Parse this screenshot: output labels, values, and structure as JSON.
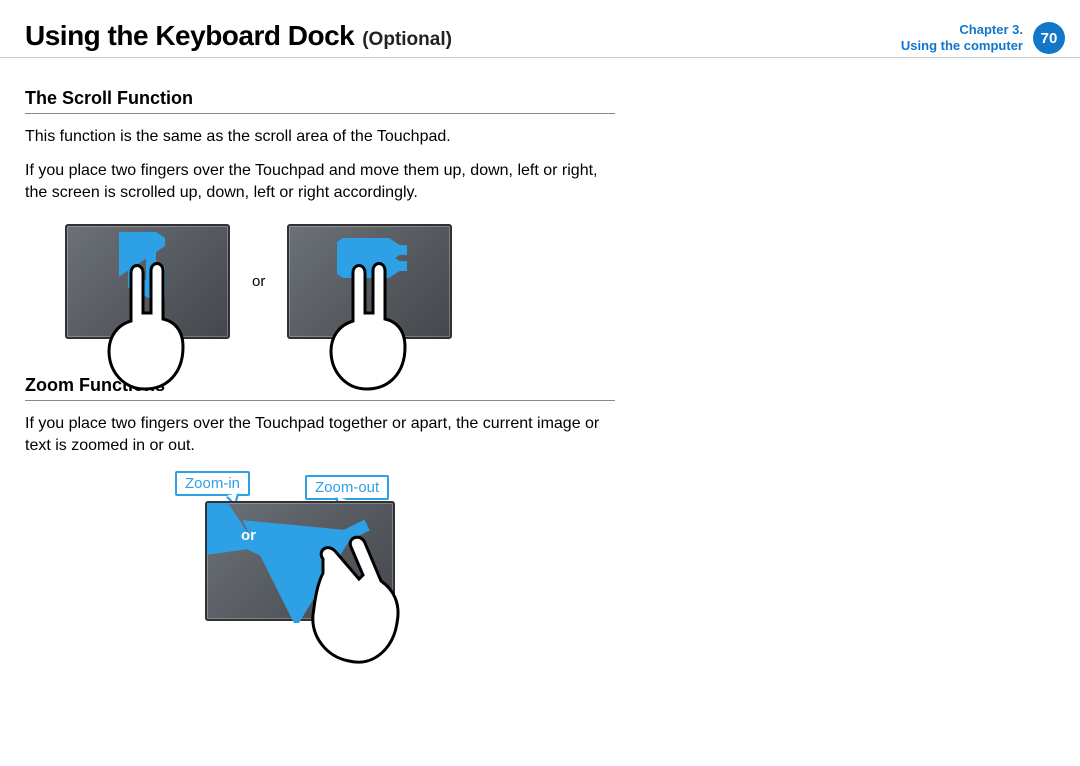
{
  "header": {
    "title_main": "Using the Keyboard Dock",
    "title_sub": "(Optional)",
    "chapter_line1": "Chapter 3.",
    "chapter_line2": "Using the computer",
    "page_number": "70"
  },
  "scroll": {
    "heading": "The Scroll Function",
    "p1": "This function is the same as the scroll area of the Touchpad.",
    "p2": "If you place two fingers over the Touchpad and move them up, down, left or right, the screen is scrolled up, down, left or right accordingly.",
    "or": "or"
  },
  "zoom": {
    "heading": "Zoom Functions",
    "p1": "If you place two fingers over the Touchpad together or apart, the current image or text is zoomed in or out.",
    "label_in": "Zoom-in",
    "label_out": "Zoom-out",
    "or": "or"
  }
}
